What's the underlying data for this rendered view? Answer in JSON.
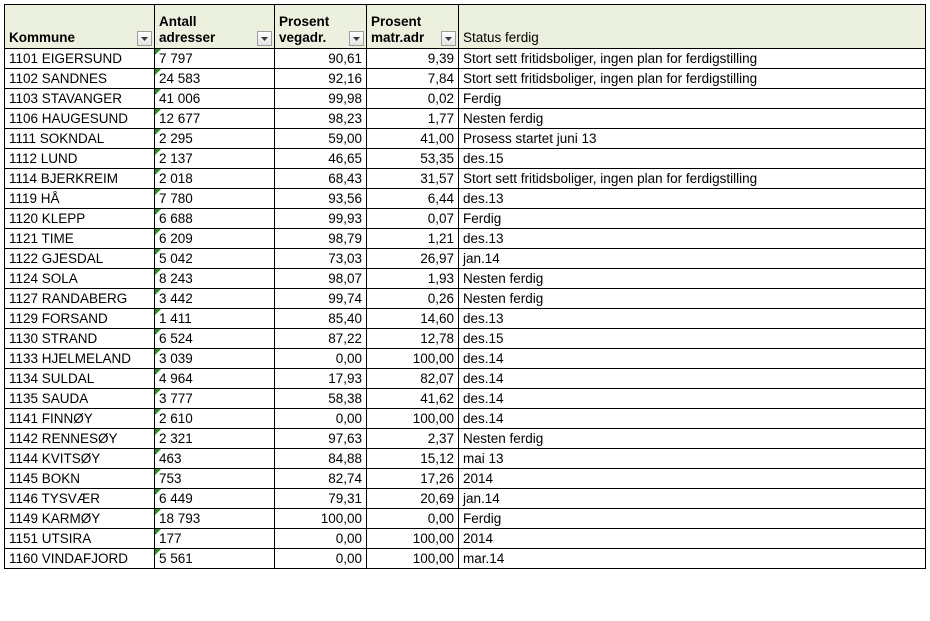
{
  "columns": {
    "kommune": "Kommune",
    "antall": "Antall adresser",
    "vegadr": "Prosent vegadr.",
    "matradr": "Prosent matr.adr",
    "status": "Status ferdig"
  },
  "chart_data": {
    "type": "table",
    "columns": [
      "Kommune",
      "Antall adresser",
      "Prosent vegadr.",
      "Prosent matr.adr",
      "Status ferdig"
    ],
    "rows": [
      {
        "kommune": "1101 EIGERSUND",
        "antall": "7 797",
        "vegadr": "90,61",
        "matradr": "9,39",
        "status": "Stort sett fritidsboliger, ingen plan for ferdigstilling"
      },
      {
        "kommune": "1102 SANDNES",
        "antall": "24 583",
        "vegadr": "92,16",
        "matradr": "7,84",
        "status": "Stort sett fritidsboliger, ingen plan for ferdigstilling"
      },
      {
        "kommune": "1103 STAVANGER",
        "antall": "41 006",
        "vegadr": "99,98",
        "matradr": "0,02",
        "status": "Ferdig"
      },
      {
        "kommune": "1106 HAUGESUND",
        "antall": "12 677",
        "vegadr": "98,23",
        "matradr": "1,77",
        "status": "Nesten ferdig"
      },
      {
        "kommune": "1111 SOKNDAL",
        "antall": "2 295",
        "vegadr": "59,00",
        "matradr": "41,00",
        "status": "Prosess startet juni 13"
      },
      {
        "kommune": "1112 LUND",
        "antall": "2 137",
        "vegadr": "46,65",
        "matradr": "53,35",
        "status": "des.15"
      },
      {
        "kommune": "1114 BJERKREIM",
        "antall": "2 018",
        "vegadr": "68,43",
        "matradr": "31,57",
        "status": "Stort sett fritidsboliger, ingen plan for ferdigstilling"
      },
      {
        "kommune": "1119 HÅ",
        "antall": "7 780",
        "vegadr": "93,56",
        "matradr": "6,44",
        "status": "des.13"
      },
      {
        "kommune": "1120 KLEPP",
        "antall": "6 688",
        "vegadr": "99,93",
        "matradr": "0,07",
        "status": "Ferdig"
      },
      {
        "kommune": "1121 TIME",
        "antall": "6 209",
        "vegadr": "98,79",
        "matradr": "1,21",
        "status": "des.13"
      },
      {
        "kommune": "1122 GJESDAL",
        "antall": "5 042",
        "vegadr": "73,03",
        "matradr": "26,97",
        "status": "jan.14"
      },
      {
        "kommune": "1124 SOLA",
        "antall": "8 243",
        "vegadr": "98,07",
        "matradr": "1,93",
        "status": "Nesten ferdig"
      },
      {
        "kommune": "1127 RANDABERG",
        "antall": "3 442",
        "vegadr": "99,74",
        "matradr": "0,26",
        "status": "Nesten ferdig"
      },
      {
        "kommune": "1129 FORSAND",
        "antall": "1 411",
        "vegadr": "85,40",
        "matradr": "14,60",
        "status": "des.13"
      },
      {
        "kommune": "1130 STRAND",
        "antall": "6 524",
        "vegadr": "87,22",
        "matradr": "12,78",
        "status": "des.15"
      },
      {
        "kommune": "1133 HJELMELAND",
        "antall": "3 039",
        "vegadr": "0,00",
        "matradr": "100,00",
        "status": "des.14"
      },
      {
        "kommune": "1134 SULDAL",
        "antall": "4 964",
        "vegadr": "17,93",
        "matradr": "82,07",
        "status": "des.14"
      },
      {
        "kommune": "1135 SAUDA",
        "antall": "3 777",
        "vegadr": "58,38",
        "matradr": "41,62",
        "status": "des.14"
      },
      {
        "kommune": "1141 FINNØY",
        "antall": "2 610",
        "vegadr": "0,00",
        "matradr": "100,00",
        "status": "des.14"
      },
      {
        "kommune": "1142 RENNESØY",
        "antall": "2 321",
        "vegadr": "97,63",
        "matradr": "2,37",
        "status": "Nesten ferdig"
      },
      {
        "kommune": "1144 KVITSØY",
        "antall": "463",
        "vegadr": "84,88",
        "matradr": "15,12",
        "status": " mai 13"
      },
      {
        "kommune": "1145 BOKN",
        "antall": "753",
        "vegadr": "82,74",
        "matradr": "17,26",
        "status": "2014"
      },
      {
        "kommune": "1146 TYSVÆR",
        "antall": "6 449",
        "vegadr": "79,31",
        "matradr": "20,69",
        "status": "jan.14"
      },
      {
        "kommune": "1149 KARMØY",
        "antall": "18 793",
        "vegadr": "100,00",
        "matradr": "0,00",
        "status": "Ferdig"
      },
      {
        "kommune": "1151 UTSIRA",
        "antall": "177",
        "vegadr": "0,00",
        "matradr": "100,00",
        "status": "2014"
      },
      {
        "kommune": "1160 VINDAFJORD",
        "antall": "5 561",
        "vegadr": "0,00",
        "matradr": "100,00",
        "status": "mar.14"
      }
    ]
  }
}
